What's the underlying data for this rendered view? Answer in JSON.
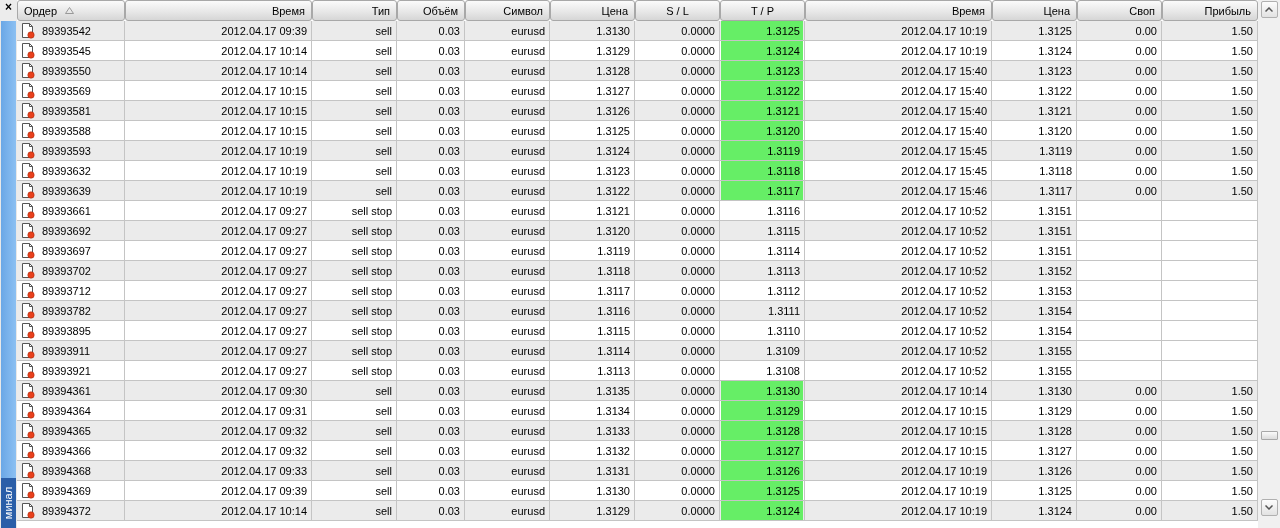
{
  "side_panel": {
    "close": "×",
    "label": "минал"
  },
  "columns": [
    {
      "label": "Ордер",
      "sorted": true
    },
    {
      "label": "Время",
      "sorted": false
    },
    {
      "label": "Тип",
      "sorted": false
    },
    {
      "label": "Объём",
      "sorted": false
    },
    {
      "label": "Символ",
      "sorted": false
    },
    {
      "label": "Цена",
      "sorted": false
    },
    {
      "label": "S / L",
      "sorted": false
    },
    {
      "label": "T / P",
      "sorted": false
    },
    {
      "label": "Время",
      "sorted": false
    },
    {
      "label": "Цена",
      "sorted": false
    },
    {
      "label": "Своп",
      "sorted": false
    },
    {
      "label": "Прибыль",
      "sorted": false
    }
  ],
  "rows": [
    {
      "order": "89393542",
      "open_time": "2012.04.17 09:39",
      "type": "sell",
      "volume": "0.03",
      "symbol": "eurusd",
      "open_price": "1.3130",
      "sl": "0.0000",
      "tp": "1.3125",
      "tp_hit": true,
      "close_time": "2012.04.17 10:19",
      "close_price": "1.3125",
      "swap": "0.00",
      "profit": "1.50"
    },
    {
      "order": "89393545",
      "open_time": "2012.04.17 10:14",
      "type": "sell",
      "volume": "0.03",
      "symbol": "eurusd",
      "open_price": "1.3129",
      "sl": "0.0000",
      "tp": "1.3124",
      "tp_hit": true,
      "close_time": "2012.04.17 10:19",
      "close_price": "1.3124",
      "swap": "0.00",
      "profit": "1.50"
    },
    {
      "order": "89393550",
      "open_time": "2012.04.17 10:14",
      "type": "sell",
      "volume": "0.03",
      "symbol": "eurusd",
      "open_price": "1.3128",
      "sl": "0.0000",
      "tp": "1.3123",
      "tp_hit": true,
      "close_time": "2012.04.17 15:40",
      "close_price": "1.3123",
      "swap": "0.00",
      "profit": "1.50"
    },
    {
      "order": "89393569",
      "open_time": "2012.04.17 10:15",
      "type": "sell",
      "volume": "0.03",
      "symbol": "eurusd",
      "open_price": "1.3127",
      "sl": "0.0000",
      "tp": "1.3122",
      "tp_hit": true,
      "close_time": "2012.04.17 15:40",
      "close_price": "1.3122",
      "swap": "0.00",
      "profit": "1.50"
    },
    {
      "order": "89393581",
      "open_time": "2012.04.17 10:15",
      "type": "sell",
      "volume": "0.03",
      "symbol": "eurusd",
      "open_price": "1.3126",
      "sl": "0.0000",
      "tp": "1.3121",
      "tp_hit": true,
      "close_time": "2012.04.17 15:40",
      "close_price": "1.3121",
      "swap": "0.00",
      "profit": "1.50"
    },
    {
      "order": "89393588",
      "open_time": "2012.04.17 10:15",
      "type": "sell",
      "volume": "0.03",
      "symbol": "eurusd",
      "open_price": "1.3125",
      "sl": "0.0000",
      "tp": "1.3120",
      "tp_hit": true,
      "close_time": "2012.04.17 15:40",
      "close_price": "1.3120",
      "swap": "0.00",
      "profit": "1.50"
    },
    {
      "order": "89393593",
      "open_time": "2012.04.17 10:19",
      "type": "sell",
      "volume": "0.03",
      "symbol": "eurusd",
      "open_price": "1.3124",
      "sl": "0.0000",
      "tp": "1.3119",
      "tp_hit": true,
      "close_time": "2012.04.17 15:45",
      "close_price": "1.3119",
      "swap": "0.00",
      "profit": "1.50"
    },
    {
      "order": "89393632",
      "open_time": "2012.04.17 10:19",
      "type": "sell",
      "volume": "0.03",
      "symbol": "eurusd",
      "open_price": "1.3123",
      "sl": "0.0000",
      "tp": "1.3118",
      "tp_hit": true,
      "close_time": "2012.04.17 15:45",
      "close_price": "1.3118",
      "swap": "0.00",
      "profit": "1.50"
    },
    {
      "order": "89393639",
      "open_time": "2012.04.17 10:19",
      "type": "sell",
      "volume": "0.03",
      "symbol": "eurusd",
      "open_price": "1.3122",
      "sl": "0.0000",
      "tp": "1.3117",
      "tp_hit": true,
      "close_time": "2012.04.17 15:46",
      "close_price": "1.3117",
      "swap": "0.00",
      "profit": "1.50"
    },
    {
      "order": "89393661",
      "open_time": "2012.04.17 09:27",
      "type": "sell stop",
      "volume": "0.03",
      "symbol": "eurusd",
      "open_price": "1.3121",
      "sl": "0.0000",
      "tp": "1.3116",
      "tp_hit": false,
      "close_time": "2012.04.17 10:52",
      "close_price": "1.3151"
    },
    {
      "order": "89393692",
      "open_time": "2012.04.17 09:27",
      "type": "sell stop",
      "volume": "0.03",
      "symbol": "eurusd",
      "open_price": "1.3120",
      "sl": "0.0000",
      "tp": "1.3115",
      "tp_hit": false,
      "close_time": "2012.04.17 10:52",
      "close_price": "1.3151"
    },
    {
      "order": "89393697",
      "open_time": "2012.04.17 09:27",
      "type": "sell stop",
      "volume": "0.03",
      "symbol": "eurusd",
      "open_price": "1.3119",
      "sl": "0.0000",
      "tp": "1.3114",
      "tp_hit": false,
      "close_time": "2012.04.17 10:52",
      "close_price": "1.3151"
    },
    {
      "order": "89393702",
      "open_time": "2012.04.17 09:27",
      "type": "sell stop",
      "volume": "0.03",
      "symbol": "eurusd",
      "open_price": "1.3118",
      "sl": "0.0000",
      "tp": "1.3113",
      "tp_hit": false,
      "close_time": "2012.04.17 10:52",
      "close_price": "1.3152"
    },
    {
      "order": "89393712",
      "open_time": "2012.04.17 09:27",
      "type": "sell stop",
      "volume": "0.03",
      "symbol": "eurusd",
      "open_price": "1.3117",
      "sl": "0.0000",
      "tp": "1.3112",
      "tp_hit": false,
      "close_time": "2012.04.17 10:52",
      "close_price": "1.3153"
    },
    {
      "order": "89393782",
      "open_time": "2012.04.17 09:27",
      "type": "sell stop",
      "volume": "0.03",
      "symbol": "eurusd",
      "open_price": "1.3116",
      "sl": "0.0000",
      "tp": "1.3111",
      "tp_hit": false,
      "close_time": "2012.04.17 10:52",
      "close_price": "1.3154"
    },
    {
      "order": "89393895",
      "open_time": "2012.04.17 09:27",
      "type": "sell stop",
      "volume": "0.03",
      "symbol": "eurusd",
      "open_price": "1.3115",
      "sl": "0.0000",
      "tp": "1.3110",
      "tp_hit": false,
      "close_time": "2012.04.17 10:52",
      "close_price": "1.3154"
    },
    {
      "order": "89393911",
      "open_time": "2012.04.17 09:27",
      "type": "sell stop",
      "volume": "0.03",
      "symbol": "eurusd",
      "open_price": "1.3114",
      "sl": "0.0000",
      "tp": "1.3109",
      "tp_hit": false,
      "close_time": "2012.04.17 10:52",
      "close_price": "1.3155"
    },
    {
      "order": "89393921",
      "open_time": "2012.04.17 09:27",
      "type": "sell stop",
      "volume": "0.03",
      "symbol": "eurusd",
      "open_price": "1.3113",
      "sl": "0.0000",
      "tp": "1.3108",
      "tp_hit": false,
      "close_time": "2012.04.17 10:52",
      "close_price": "1.3155"
    },
    {
      "order": "89394361",
      "open_time": "2012.04.17 09:30",
      "type": "sell",
      "volume": "0.03",
      "symbol": "eurusd",
      "open_price": "1.3135",
      "sl": "0.0000",
      "tp": "1.3130",
      "tp_hit": true,
      "close_time": "2012.04.17 10:14",
      "close_price": "1.3130",
      "swap": "0.00",
      "profit": "1.50"
    },
    {
      "order": "89394364",
      "open_time": "2012.04.17 09:31",
      "type": "sell",
      "volume": "0.03",
      "symbol": "eurusd",
      "open_price": "1.3134",
      "sl": "0.0000",
      "tp": "1.3129",
      "tp_hit": true,
      "close_time": "2012.04.17 10:15",
      "close_price": "1.3129",
      "swap": "0.00",
      "profit": "1.50"
    },
    {
      "order": "89394365",
      "open_time": "2012.04.17 09:32",
      "type": "sell",
      "volume": "0.03",
      "symbol": "eurusd",
      "open_price": "1.3133",
      "sl": "0.0000",
      "tp": "1.3128",
      "tp_hit": true,
      "close_time": "2012.04.17 10:15",
      "close_price": "1.3128",
      "swap": "0.00",
      "profit": "1.50"
    },
    {
      "order": "89394366",
      "open_time": "2012.04.17 09:32",
      "type": "sell",
      "volume": "0.03",
      "symbol": "eurusd",
      "open_price": "1.3132",
      "sl": "0.0000",
      "tp": "1.3127",
      "tp_hit": true,
      "close_time": "2012.04.17 10:15",
      "close_price": "1.3127",
      "swap": "0.00",
      "profit": "1.50"
    },
    {
      "order": "89394368",
      "open_time": "2012.04.17 09:33",
      "type": "sell",
      "volume": "0.03",
      "symbol": "eurusd",
      "open_price": "1.3131",
      "sl": "0.0000",
      "tp": "1.3126",
      "tp_hit": true,
      "close_time": "2012.04.17 10:19",
      "close_price": "1.3126",
      "swap": "0.00",
      "profit": "1.50"
    },
    {
      "order": "89394369",
      "open_time": "2012.04.17 09:39",
      "type": "sell",
      "volume": "0.03",
      "symbol": "eurusd",
      "open_price": "1.3130",
      "sl": "0.0000",
      "tp": "1.3125",
      "tp_hit": true,
      "close_time": "2012.04.17 10:19",
      "close_price": "1.3125",
      "swap": "0.00",
      "profit": "1.50"
    },
    {
      "order": "89394372",
      "open_time": "2012.04.17 10:14",
      "type": "sell",
      "volume": "0.03",
      "symbol": "eurusd",
      "open_price": "1.3129",
      "sl": "0.0000",
      "tp": "1.3124",
      "tp_hit": true,
      "close_time": "2012.04.17 10:19",
      "close_price": "1.3124",
      "swap": "0.00",
      "profit": "1.50"
    }
  ]
}
